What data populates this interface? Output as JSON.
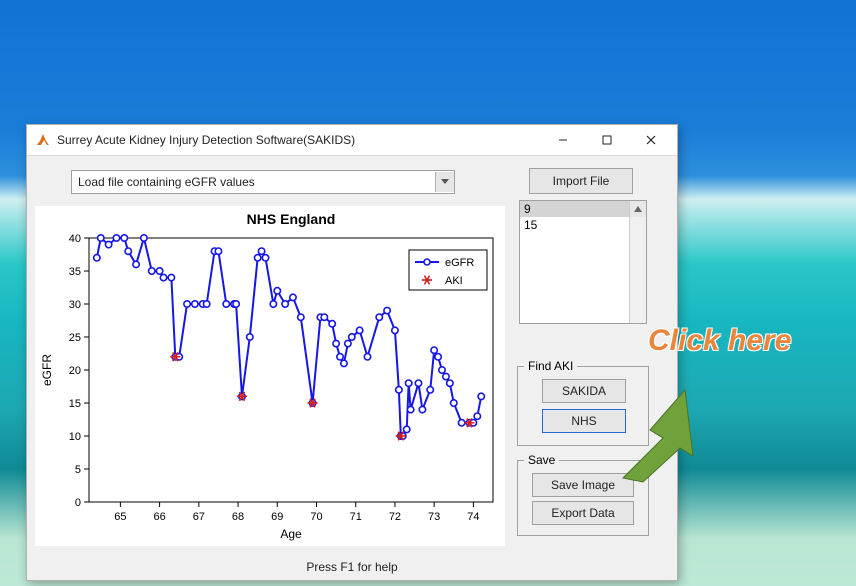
{
  "window": {
    "title": "Surrey Acute Kidney Injury Detection Software(SAKIDS)"
  },
  "controls": {
    "file_select_label": "Load file containing eGFR values",
    "import_label": "Import File"
  },
  "listbox": {
    "items": [
      "9",
      "15"
    ],
    "selected_index": 0
  },
  "findaki": {
    "title": "Find AKI",
    "sakida_label": "SAKIDA",
    "nhs_label": "NHS"
  },
  "save": {
    "title": "Save",
    "save_image_label": "Save Image",
    "export_label": "Export Data"
  },
  "help_text": "Press F1 for help",
  "annotation": {
    "text": "Click here"
  },
  "chart_data": {
    "type": "line",
    "title": "NHS England",
    "xlabel": "Age",
    "ylabel": "eGFR",
    "xlim": [
      64.2,
      74.5
    ],
    "ylim": [
      0,
      40
    ],
    "series": [
      {
        "name": "eGFR",
        "x": [
          64.4,
          64.5,
          64.7,
          64.9,
          65.1,
          65.2,
          65.4,
          65.6,
          65.8,
          66.0,
          66.1,
          66.3,
          66.4,
          66.5,
          66.7,
          66.9,
          67.1,
          67.2,
          67.4,
          67.5,
          67.7,
          67.9,
          67.95,
          68.1,
          68.3,
          68.5,
          68.6,
          68.7,
          68.9,
          69.0,
          69.2,
          69.4,
          69.6,
          69.9,
          70.1,
          70.2,
          70.4,
          70.5,
          70.6,
          70.7,
          70.8,
          70.9,
          71.1,
          71.3,
          71.6,
          71.8,
          72.0,
          72.1,
          72.15,
          72.2,
          72.3,
          72.35,
          72.4,
          72.6,
          72.7,
          72.9,
          73.0,
          73.1,
          73.2,
          73.3,
          73.4,
          73.5,
          73.7,
          73.9,
          74.0,
          74.1,
          74.2
        ],
        "y": [
          37,
          40,
          39,
          40,
          40,
          38,
          36,
          40,
          35,
          35,
          34,
          34,
          22,
          22,
          30,
          30,
          30,
          30,
          38,
          38,
          30,
          30,
          30,
          16,
          25,
          37,
          38,
          37,
          30,
          32,
          30,
          31,
          28,
          15,
          28,
          28,
          27,
          24,
          22,
          21,
          24,
          25,
          26,
          22,
          28,
          29,
          26,
          17,
          10,
          10,
          11,
          18,
          14,
          18,
          14,
          17,
          23,
          22,
          20,
          19,
          18,
          15,
          12,
          12,
          12,
          13,
          16
        ]
      },
      {
        "name": "AKI",
        "x": [
          66.4,
          68.1,
          69.9,
          72.15,
          73.9
        ],
        "y": [
          22,
          16,
          15,
          10,
          12
        ]
      }
    ],
    "xticks": [
      65,
      66,
      67,
      68,
      69,
      70,
      71,
      72,
      73,
      74
    ],
    "yticks": [
      0,
      5,
      10,
      15,
      20,
      25,
      30,
      35,
      40
    ]
  }
}
